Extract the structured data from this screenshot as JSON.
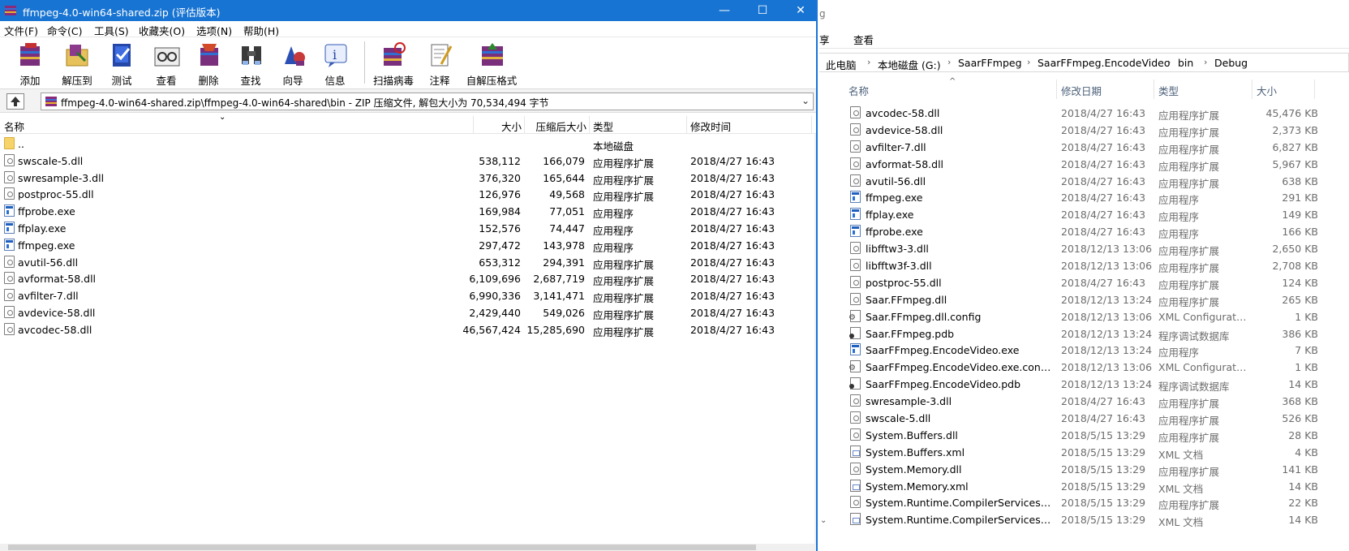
{
  "winrar": {
    "title": "ffmpeg-4.0-win64-shared.zip (评估版本)",
    "window_controls": {
      "minimize": "—",
      "maximize": "☐",
      "close": "✕"
    },
    "menu": [
      "文件(F)",
      "命令(C)",
      "工具(S)",
      "收藏夹(O)",
      "选项(N)",
      "帮助(H)"
    ],
    "toolbar": [
      {
        "label": "添加",
        "icon": "add-archive-icon"
      },
      {
        "label": "解压到",
        "icon": "extract-to-icon"
      },
      {
        "label": "测试",
        "icon": "test-icon"
      },
      {
        "label": "查看",
        "icon": "view-icon"
      },
      {
        "label": "删除",
        "icon": "delete-icon"
      },
      {
        "label": "查找",
        "icon": "find-icon"
      },
      {
        "label": "向导",
        "icon": "wizard-icon"
      },
      {
        "label": "信息",
        "icon": "info-icon"
      },
      {
        "label": "扫描病毒",
        "icon": "virus-scan-icon"
      },
      {
        "label": "注释",
        "icon": "comment-icon"
      },
      {
        "label": "自解压格式",
        "icon": "sfx-icon"
      }
    ],
    "address": "ffmpeg-4.0-win64-shared.zip\\ffmpeg-4.0-win64-shared\\bin - ZIP 压缩文件, 解包大小为 70,534,494 字节",
    "columns": {
      "name": "名称",
      "size": "大小",
      "packed": "压缩后大小",
      "type": "类型",
      "modified": "修改时间"
    },
    "files": [
      {
        "name": "..",
        "size": "",
        "packed": "",
        "type": "本地磁盘",
        "modified": "",
        "kind": "folder"
      },
      {
        "name": "swscale-5.dll",
        "size": "538,112",
        "packed": "166,079",
        "type": "应用程序扩展",
        "modified": "2018/4/27 16:43",
        "kind": "dll"
      },
      {
        "name": "swresample-3.dll",
        "size": "376,320",
        "packed": "165,644",
        "type": "应用程序扩展",
        "modified": "2018/4/27 16:43",
        "kind": "dll"
      },
      {
        "name": "postproc-55.dll",
        "size": "126,976",
        "packed": "49,568",
        "type": "应用程序扩展",
        "modified": "2018/4/27 16:43",
        "kind": "dll"
      },
      {
        "name": "ffprobe.exe",
        "size": "169,984",
        "packed": "77,051",
        "type": "应用程序",
        "modified": "2018/4/27 16:43",
        "kind": "exe"
      },
      {
        "name": "ffplay.exe",
        "size": "152,576",
        "packed": "74,447",
        "type": "应用程序",
        "modified": "2018/4/27 16:43",
        "kind": "exe"
      },
      {
        "name": "ffmpeg.exe",
        "size": "297,472",
        "packed": "143,978",
        "type": "应用程序",
        "modified": "2018/4/27 16:43",
        "kind": "exe"
      },
      {
        "name": "avutil-56.dll",
        "size": "653,312",
        "packed": "294,391",
        "type": "应用程序扩展",
        "modified": "2018/4/27 16:43",
        "kind": "dll"
      },
      {
        "name": "avformat-58.dll",
        "size": "6,109,696",
        "packed": "2,687,719",
        "type": "应用程序扩展",
        "modified": "2018/4/27 16:43",
        "kind": "dll"
      },
      {
        "name": "avfilter-7.dll",
        "size": "6,990,336",
        "packed": "3,141,471",
        "type": "应用程序扩展",
        "modified": "2018/4/27 16:43",
        "kind": "dll"
      },
      {
        "name": "avdevice-58.dll",
        "size": "2,429,440",
        "packed": "549,026",
        "type": "应用程序扩展",
        "modified": "2018/4/27 16:43",
        "kind": "dll"
      },
      {
        "name": "avcodec-58.dll",
        "size": "46,567,424",
        "packed": "15,285,690",
        "type": "应用程序扩展",
        "modified": "2018/4/27 16:43",
        "kind": "dll"
      }
    ]
  },
  "explorer": {
    "ribbon_tab": "查看",
    "ribbon_cut": "享",
    "partial_title": "g",
    "breadcrumbs": [
      "此电脑",
      "本地磁盘 (G:)",
      "SaarFFmpeg",
      "SaarFFmpeg.EncodeVideo",
      "bin",
      "Debug"
    ],
    "columns": {
      "name": "名称",
      "date": "修改日期",
      "type": "类型",
      "size": "大小"
    },
    "files": [
      {
        "name": "avcodec-58.dll",
        "date": "2018/4/27 16:43",
        "type": "应用程序扩展",
        "size": "45,476 KB",
        "kind": "dll"
      },
      {
        "name": "avdevice-58.dll",
        "date": "2018/4/27 16:43",
        "type": "应用程序扩展",
        "size": "2,373 KB",
        "kind": "dll"
      },
      {
        "name": "avfilter-7.dll",
        "date": "2018/4/27 16:43",
        "type": "应用程序扩展",
        "size": "6,827 KB",
        "kind": "dll"
      },
      {
        "name": "avformat-58.dll",
        "date": "2018/4/27 16:43",
        "type": "应用程序扩展",
        "size": "5,967 KB",
        "kind": "dll"
      },
      {
        "name": "avutil-56.dll",
        "date": "2018/4/27 16:43",
        "type": "应用程序扩展",
        "size": "638 KB",
        "kind": "dll"
      },
      {
        "name": "ffmpeg.exe",
        "date": "2018/4/27 16:43",
        "type": "应用程序",
        "size": "291 KB",
        "kind": "exe"
      },
      {
        "name": "ffplay.exe",
        "date": "2018/4/27 16:43",
        "type": "应用程序",
        "size": "149 KB",
        "kind": "exe"
      },
      {
        "name": "ffprobe.exe",
        "date": "2018/4/27 16:43",
        "type": "应用程序",
        "size": "166 KB",
        "kind": "exe"
      },
      {
        "name": "libfftw3-3.dll",
        "date": "2018/12/13 13:06",
        "type": "应用程序扩展",
        "size": "2,650 KB",
        "kind": "dll"
      },
      {
        "name": "libfftw3f-3.dll",
        "date": "2018/12/13 13:06",
        "type": "应用程序扩展",
        "size": "2,708 KB",
        "kind": "dll"
      },
      {
        "name": "postproc-55.dll",
        "date": "2018/4/27 16:43",
        "type": "应用程序扩展",
        "size": "124 KB",
        "kind": "dll"
      },
      {
        "name": "Saar.FFmpeg.dll",
        "date": "2018/12/13 13:24",
        "type": "应用程序扩展",
        "size": "265 KB",
        "kind": "dll"
      },
      {
        "name": "Saar.FFmpeg.dll.config",
        "date": "2018/12/13 13:06",
        "type": "XML Configurati...",
        "size": "1 KB",
        "kind": "cfg"
      },
      {
        "name": "Saar.FFmpeg.pdb",
        "date": "2018/12/13 13:24",
        "type": "程序调试数据库",
        "size": "386 KB",
        "kind": "pdb"
      },
      {
        "name": "SaarFFmpeg.EncodeVideo.exe",
        "date": "2018/12/13 13:24",
        "type": "应用程序",
        "size": "7 KB",
        "kind": "exe"
      },
      {
        "name": "SaarFFmpeg.EncodeVideo.exe.config",
        "date": "2018/12/13 13:06",
        "type": "XML Configurati...",
        "size": "1 KB",
        "kind": "cfg"
      },
      {
        "name": "SaarFFmpeg.EncodeVideo.pdb",
        "date": "2018/12/13 13:24",
        "type": "程序调试数据库",
        "size": "14 KB",
        "kind": "pdb"
      },
      {
        "name": "swresample-3.dll",
        "date": "2018/4/27 16:43",
        "type": "应用程序扩展",
        "size": "368 KB",
        "kind": "dll"
      },
      {
        "name": "swscale-5.dll",
        "date": "2018/4/27 16:43",
        "type": "应用程序扩展",
        "size": "526 KB",
        "kind": "dll"
      },
      {
        "name": "System.Buffers.dll",
        "date": "2018/5/15 13:29",
        "type": "应用程序扩展",
        "size": "28 KB",
        "kind": "dll"
      },
      {
        "name": "System.Buffers.xml",
        "date": "2018/5/15 13:29",
        "type": "XML 文档",
        "size": "4 KB",
        "kind": "xml"
      },
      {
        "name": "System.Memory.dll",
        "date": "2018/5/15 13:29",
        "type": "应用程序扩展",
        "size": "141 KB",
        "kind": "dll"
      },
      {
        "name": "System.Memory.xml",
        "date": "2018/5/15 13:29",
        "type": "XML 文档",
        "size": "14 KB",
        "kind": "xml"
      },
      {
        "name": "System.Runtime.CompilerServices.Un...",
        "date": "2018/5/15 13:29",
        "type": "应用程序扩展",
        "size": "22 KB",
        "kind": "dll"
      },
      {
        "name": "System.Runtime.CompilerServices.Un...",
        "date": "2018/5/15 13:29",
        "type": "XML 文档",
        "size": "14 KB",
        "kind": "xml"
      }
    ]
  },
  "colors": {
    "titlebar": "#1874d2",
    "accent": "#1a73d9"
  }
}
